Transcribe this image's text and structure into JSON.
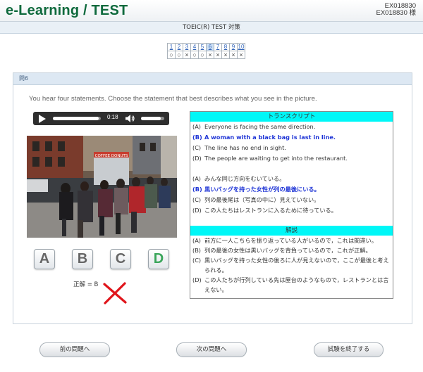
{
  "header": {
    "logo": "e-Learning / TEST",
    "user_line1": "EX018830",
    "user_line2": "EX018830 様"
  },
  "subtitle": "TOEIC(R) TEST 対策",
  "question_nav": {
    "numbers": [
      "1",
      "2",
      "3",
      "4",
      "5",
      "6",
      "7",
      "8",
      "9",
      "10"
    ],
    "current": "6",
    "results": [
      "○",
      "○",
      "×",
      "○",
      "○",
      "×",
      "×",
      "×",
      "×",
      "×"
    ]
  },
  "question": {
    "label": "問6",
    "instruction": "You hear four statements. Choose the statement that best describes what you see in the picture.",
    "player": {
      "time": "0:18",
      "progress": 0.95,
      "volume": 0.85
    },
    "photo_sign": "COFFEE DONUTS",
    "choices": [
      "A",
      "B",
      "C",
      "D"
    ],
    "answer_text": "正解 = B",
    "result_mark_icon": "red-x-icon"
  },
  "transcript": {
    "title": "トランスクリプト",
    "english": [
      {
        "label": "(A)",
        "text": "Everyone is facing the same direction."
      },
      {
        "label": "(B)",
        "text": "A woman with a black bag is last in line."
      },
      {
        "label": "(C)",
        "text": "The line has no end in sight."
      },
      {
        "label": "(D)",
        "text": "The people are waiting to get into the restaurant."
      }
    ],
    "japanese": [
      {
        "label": "(A)",
        "text": "みんな同じ方向をむいている。"
      },
      {
        "label": "(B)",
        "text": "黒いバッグを持った女性が列の最後にいる。"
      },
      {
        "label": "(C)",
        "text": "列の最後尾は（写真の中に）見えていない。"
      },
      {
        "label": "(D)",
        "text": "この人たちはレストランに入るために待っている。"
      }
    ],
    "highlight_color": "#1f35d6",
    "explanation_title": "解説",
    "explanation": [
      {
        "label": "(A)",
        "text": "前方に一人こちらを振り返っている人がいるので，これは間違い。"
      },
      {
        "label": "(B)",
        "text": "列の最後の女性は黒いバッグを背負っているので，これが正解。"
      },
      {
        "label": "(C)",
        "text": "黒いバッグを持った女性の後ろに人が見えないので，ここが最後と考えられる。"
      },
      {
        "label": "(D)",
        "text": "この人たちが行列している先は屋台のようなもので，レストランとは言えない。"
      }
    ]
  },
  "buttons": {
    "prev": "前の問題へ",
    "next": "次の問題へ",
    "finish": "試験を終了する"
  },
  "colors": {
    "logo": "#0f6a3d",
    "section_header": "#00f7f7",
    "correct_choice": "#3aa55a",
    "cross": "#e0151b"
  }
}
